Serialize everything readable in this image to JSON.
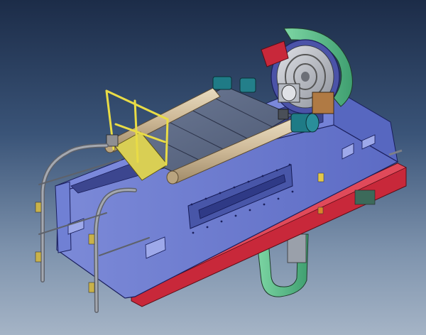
{
  "scene": {
    "kind": "cad-render",
    "subject": "conveyor-drive-machine-assembly",
    "colors": {
      "frame_blue": "#6f7fd6",
      "frame_edge": "#1a1f5c",
      "base_red": "#c8283a",
      "belt_tan": "#cdb896",
      "panel_slate": "#5d6a88",
      "motor_teal": "#1f7b86",
      "guard_green": "#5fbf8c",
      "rail_yellow": "#e9dc46",
      "handrail_grey": "#8b8f98",
      "drum_grey": "#b9bcc2"
    }
  }
}
